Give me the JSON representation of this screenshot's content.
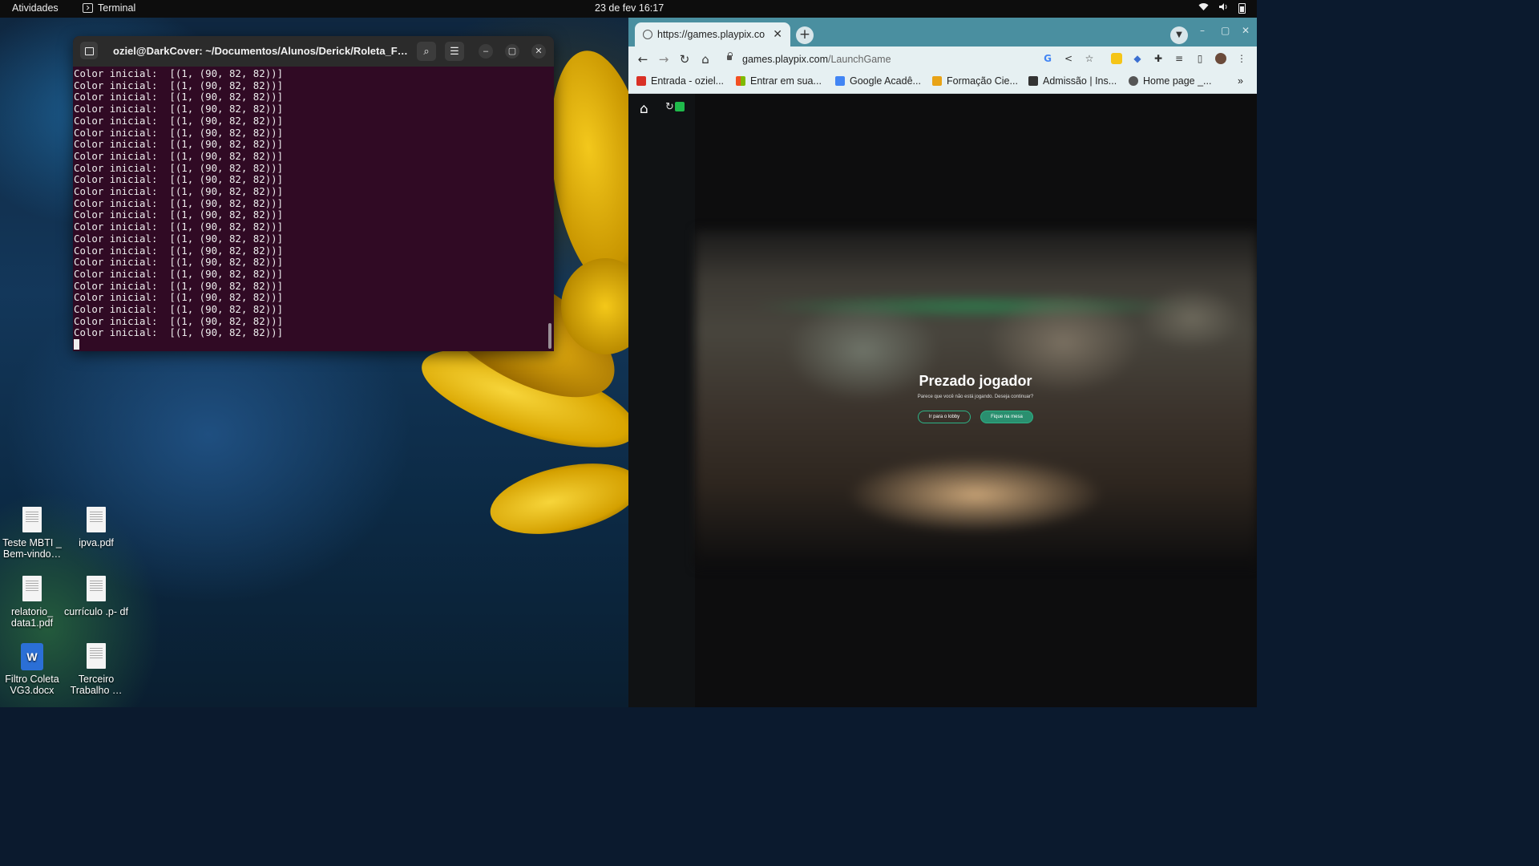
{
  "topbar": {
    "activities": "Atividades",
    "app_name": "Terminal",
    "clock": "23 de fev  16:17"
  },
  "terminal": {
    "title": "oziel@DarkCover: ~/Documentos/Alunos/Derick/Roleta_Fire...",
    "output_line": "Color inicial:  [(1, (90, 82, 82))]",
    "line_count": 23,
    "controls": {
      "search": "⌕",
      "menu": "☰",
      "minimize": "–",
      "maximize": "▢",
      "close": "✕"
    }
  },
  "desktop_icons": [
    {
      "label": "Teste MBTI _ Bem-vindo…",
      "type": "doc"
    },
    {
      "label": "ipva.pdf",
      "type": "doc"
    },
    {
      "label": "relatorio_ data1.pdf",
      "type": "doc"
    },
    {
      "label": "currículo .p- df",
      "type": "doc"
    },
    {
      "label": "Filtro Coleta VG3.docx",
      "type": "word"
    },
    {
      "label": "Terceiro Trabalho …",
      "type": "doc"
    }
  ],
  "browser": {
    "tab_title": "https://games.playpix.co",
    "url_host": "games.playpix.com",
    "url_path": "/LaunchGame",
    "bookmarks": [
      {
        "label": "Entrada - oziel...",
        "icon": "gmail-icon",
        "color": "#d93025"
      },
      {
        "label": "Entrar em sua...",
        "icon": "microsoft-icon",
        "color": "#f25022"
      },
      {
        "label": "Google Acadê...",
        "icon": "scholar-icon",
        "color": "#4285f4"
      },
      {
        "label": "Formação Cie...",
        "icon": "formacao-icon",
        "color": "#e8a317"
      },
      {
        "label": "Admissão | Ins...",
        "icon": "admissao-icon",
        "color": "#333333"
      },
      {
        "label": "Home page _...",
        "icon": "globe-icon",
        "color": "#555555"
      }
    ],
    "bookmarks_overflow": "»",
    "accent": "#4a8fa0",
    "dialog": {
      "heading": "Prezado jogador",
      "subtext": "Parece que você não está jogando. Deseja continuar?",
      "lobby_button": "Ir para o lobby",
      "stay_button": "Fique na mesa"
    }
  }
}
